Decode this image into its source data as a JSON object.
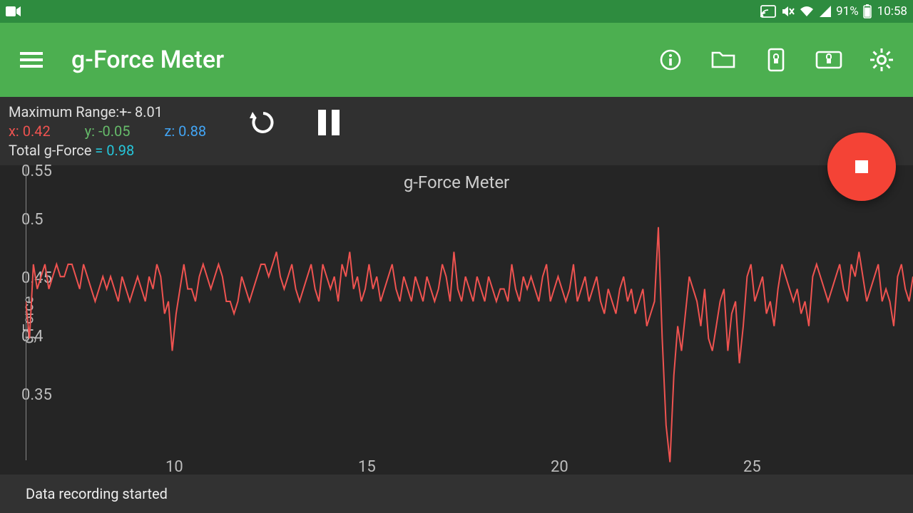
{
  "status_bar": {
    "battery_text": "91%",
    "clock": "10:58"
  },
  "app_bar": {
    "title": "g-Force Meter"
  },
  "info": {
    "max_range_label": "Maximum Range:",
    "max_range_value": "+- 8.01",
    "x_label": "x:",
    "x_value": "0.42",
    "y_label": "y:",
    "y_value": "-0.05",
    "z_label": "z:",
    "z_value": "0.88",
    "total_label": "Total g-Force",
    "total_eq": "=",
    "total_value": "0.98"
  },
  "chart": {
    "title": "g-Force Meter",
    "y_axis_label": "g-Force",
    "y_ticks": [
      "0.55",
      "0.5",
      "0.45",
      "0.4",
      "0.35"
    ],
    "x_ticks": [
      "10",
      "15",
      "20",
      "25"
    ]
  },
  "toast": "Data recording started",
  "colors": {
    "series": "#ef5350"
  },
  "chart_data": {
    "type": "line",
    "title": "g-Force Meter",
    "xlabel": "",
    "ylabel": "g-Force",
    "ylim": [
      0.3,
      0.55
    ],
    "xlim": [
      5,
      28
    ],
    "x": [
      5,
      5.1,
      5.2,
      5.3,
      5.4,
      5.5,
      5.6,
      5.7,
      5.8,
      5.9,
      6,
      6.1,
      6.2,
      6.3,
      6.4,
      6.5,
      6.6,
      6.7,
      6.8,
      6.9,
      7,
      7.1,
      7.2,
      7.3,
      7.4,
      7.5,
      7.6,
      7.7,
      7.8,
      7.9,
      8,
      8.1,
      8.2,
      8.3,
      8.4,
      8.5,
      8.6,
      8.7,
      8.8,
      8.9,
      9,
      9.1,
      9.2,
      9.3,
      9.4,
      9.5,
      9.6,
      9.7,
      9.8,
      9.9,
      10,
      10.1,
      10.2,
      10.3,
      10.4,
      10.5,
      10.6,
      10.7,
      10.8,
      10.9,
      11,
      11.1,
      11.2,
      11.3,
      11.4,
      11.5,
      11.6,
      11.7,
      11.8,
      11.9,
      12,
      12.1,
      12.2,
      12.3,
      12.4,
      12.5,
      12.6,
      12.7,
      12.8,
      12.9,
      13,
      13.1,
      13.2,
      13.3,
      13.4,
      13.5,
      13.6,
      13.7,
      13.8,
      13.9,
      14,
      14.1,
      14.2,
      14.3,
      14.4,
      14.5,
      14.6,
      14.7,
      14.8,
      14.9,
      15,
      15.1,
      15.2,
      15.3,
      15.4,
      15.5,
      15.6,
      15.7,
      15.8,
      15.9,
      16,
      16.1,
      16.2,
      16.3,
      16.4,
      16.5,
      16.6,
      16.7,
      16.8,
      16.9,
      17,
      17.1,
      17.2,
      17.3,
      17.4,
      17.5,
      17.6,
      17.7,
      17.8,
      17.9,
      18,
      18.1,
      18.2,
      18.3,
      18.4,
      18.5,
      18.6,
      18.7,
      18.8,
      18.9,
      19,
      19.1,
      19.2,
      19.3,
      19.4,
      19.5,
      19.6,
      19.7,
      19.8,
      19.9,
      20,
      20.1,
      20.2,
      20.3,
      20.4,
      20.5,
      20.6,
      20.7,
      20.8,
      20.9,
      21,
      21.1,
      21.2,
      21.3,
      21.4,
      21.5,
      21.6,
      21.7,
      21.8,
      21.9,
      22,
      22.1,
      22.2,
      22.3,
      22.4,
      22.5,
      22.6,
      22.7,
      22.8,
      22.9,
      23,
      23.1,
      23.2,
      23.3,
      23.4,
      23.5,
      23.6,
      23.7,
      23.8,
      23.9,
      24,
      24.1,
      24.2,
      24.3,
      24.4,
      24.5,
      24.6,
      24.7,
      24.8,
      24.9,
      25,
      25.1,
      25.2,
      25.3,
      25.4,
      25.5,
      25.6,
      25.7,
      25.8,
      25.9,
      26,
      26.1,
      26.2,
      26.3,
      26.4,
      26.5,
      26.6,
      26.7,
      26.8,
      26.9,
      27,
      27.1,
      27.2,
      27.3,
      27.4,
      27.5,
      27.6,
      27.7,
      27.8,
      27.9,
      28
    ],
    "values": [
      0.44,
      0.41,
      0.47,
      0.45,
      0.46,
      0.47,
      0.45,
      0.46,
      0.47,
      0.46,
      0.46,
      0.47,
      0.47,
      0.46,
      0.45,
      0.47,
      0.46,
      0.45,
      0.44,
      0.45,
      0.46,
      0.45,
      0.46,
      0.45,
      0.44,
      0.46,
      0.45,
      0.44,
      0.45,
      0.46,
      0.45,
      0.44,
      0.46,
      0.45,
      0.47,
      0.46,
      0.43,
      0.44,
      0.4,
      0.43,
      0.45,
      0.47,
      0.45,
      0.45,
      0.44,
      0.46,
      0.47,
      0.46,
      0.45,
      0.46,
      0.47,
      0.46,
      0.44,
      0.44,
      0.43,
      0.44,
      0.46,
      0.45,
      0.44,
      0.45,
      0.46,
      0.47,
      0.47,
      0.46,
      0.47,
      0.48,
      0.46,
      0.45,
      0.46,
      0.47,
      0.45,
      0.44,
      0.45,
      0.46,
      0.47,
      0.45,
      0.44,
      0.47,
      0.46,
      0.45,
      0.46,
      0.44,
      0.47,
      0.46,
      0.48,
      0.45,
      0.46,
      0.44,
      0.45,
      0.47,
      0.45,
      0.46,
      0.44,
      0.45,
      0.46,
      0.47,
      0.45,
      0.44,
      0.46,
      0.45,
      0.44,
      0.46,
      0.45,
      0.44,
      0.46,
      0.45,
      0.44,
      0.45,
      0.47,
      0.46,
      0.44,
      0.48,
      0.45,
      0.44,
      0.46,
      0.45,
      0.44,
      0.46,
      0.45,
      0.44,
      0.46,
      0.45,
      0.44,
      0.45,
      0.45,
      0.44,
      0.47,
      0.45,
      0.44,
      0.46,
      0.45,
      0.46,
      0.45,
      0.44,
      0.46,
      0.47,
      0.44,
      0.45,
      0.46,
      0.45,
      0.44,
      0.45,
      0.47,
      0.44,
      0.45,
      0.46,
      0.44,
      0.45,
      0.46,
      0.44,
      0.43,
      0.45,
      0.44,
      0.43,
      0.45,
      0.46,
      0.44,
      0.45,
      0.43,
      0.44,
      0.45,
      0.42,
      0.43,
      0.44,
      0.5,
      0.41,
      0.34,
      0.31,
      0.38,
      0.42,
      0.4,
      0.43,
      0.46,
      0.45,
      0.44,
      0.42,
      0.45,
      0.41,
      0.4,
      0.42,
      0.44,
      0.45,
      0.4,
      0.43,
      0.44,
      0.39,
      0.42,
      0.46,
      0.47,
      0.44,
      0.45,
      0.46,
      0.43,
      0.44,
      0.42,
      0.45,
      0.47,
      0.46,
      0.45,
      0.44,
      0.45,
      0.43,
      0.44,
      0.42,
      0.46,
      0.47,
      0.46,
      0.45,
      0.44,
      0.45,
      0.46,
      0.47,
      0.45,
      0.44,
      0.47,
      0.46,
      0.48,
      0.46,
      0.44,
      0.45,
      0.46,
      0.47,
      0.44,
      0.45,
      0.44,
      0.42,
      0.46,
      0.47,
      0.45,
      0.44,
      0.46
    ]
  }
}
